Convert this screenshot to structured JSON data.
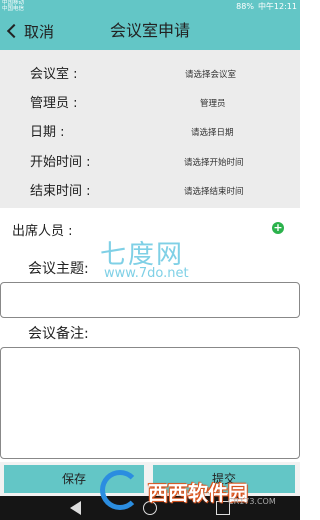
{
  "status_bar": {
    "carrier_line1": "中国移动",
    "carrier_line2": "中国电信",
    "battery": "88%",
    "time": "中午12:11"
  },
  "header": {
    "back_label": "取消",
    "title": "会议室申请"
  },
  "form": {
    "rows": [
      {
        "label": "会议室 :",
        "value": "请选择会议室"
      },
      {
        "label": "管理员 :",
        "value": "管理员"
      },
      {
        "label": "日期 :",
        "value": "请选择日期"
      },
      {
        "label": "开始时间 :",
        "value": "请选择开始时间"
      },
      {
        "label": "结束时间 :",
        "value": "请选择结束时间"
      }
    ],
    "attendees_label": "出席人员 :",
    "topic_label": "会议主题:",
    "topic_value": "",
    "notes_label": "会议备注:",
    "notes_value": ""
  },
  "watermark": {
    "line1": "七度网",
    "line2": "www.7do.net"
  },
  "buttons": {
    "save": "保存",
    "submit": "提交"
  },
  "logo": {
    "text": "西西软件园",
    "domain": "CR173.COM"
  }
}
